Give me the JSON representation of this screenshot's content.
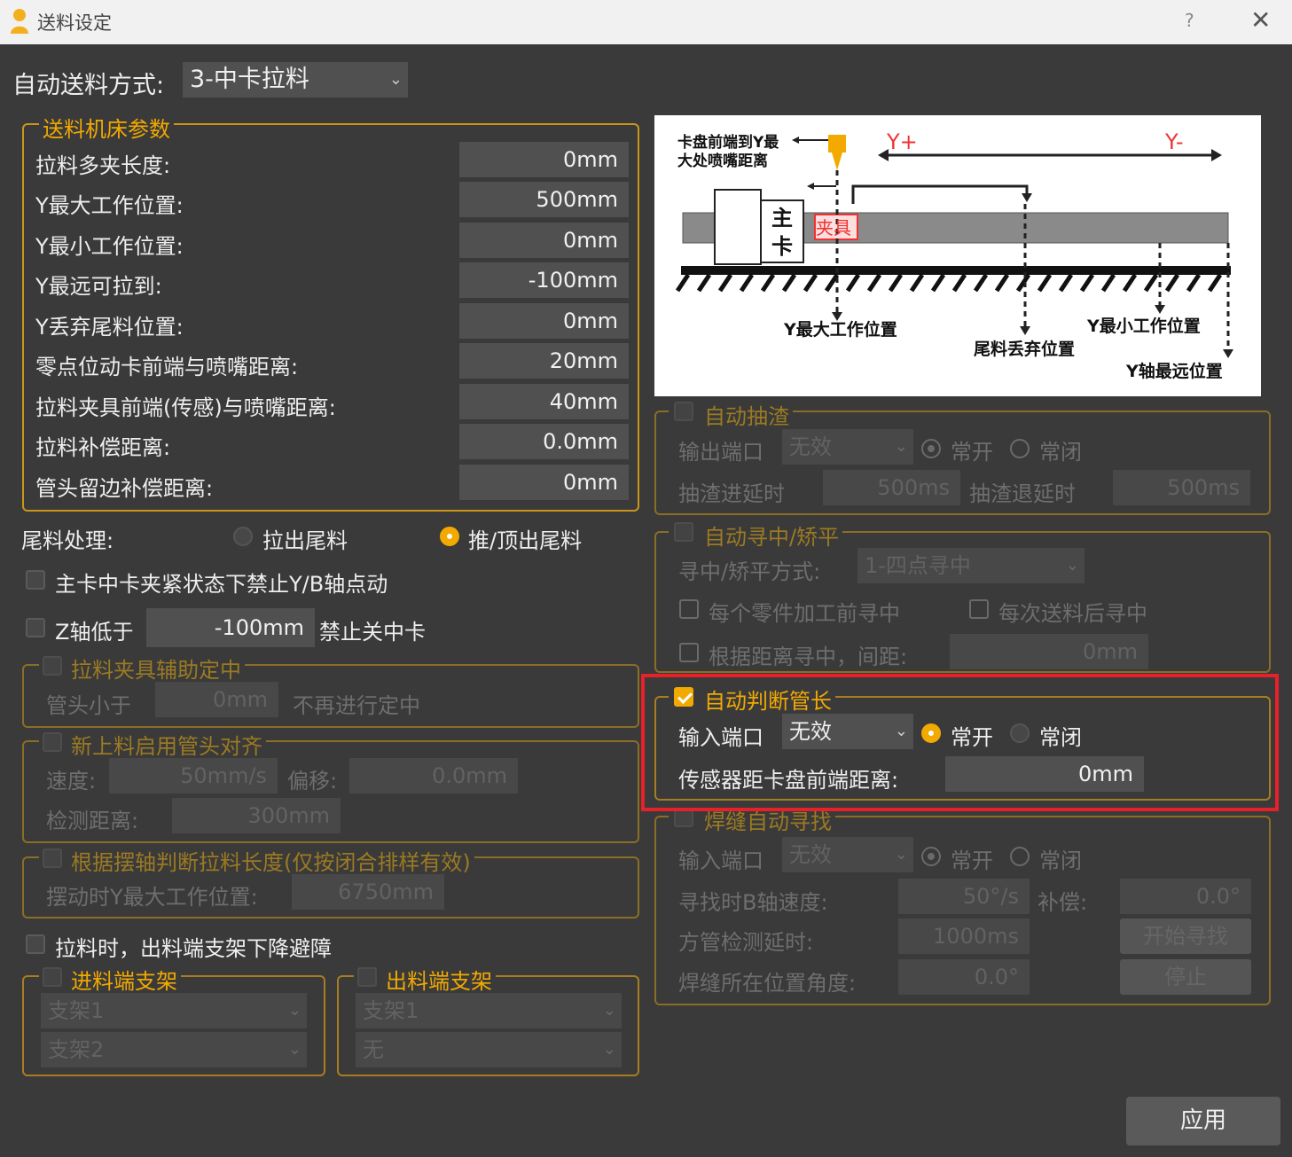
{
  "window": {
    "title": "送料设定",
    "help": "?",
    "close": "✕"
  },
  "auto_feed": {
    "label": "自动送料方式:",
    "value": "3-中卡拉料"
  },
  "machine_params": {
    "title": "送料机床参数",
    "rows": [
      {
        "label": "拉料多夹长度:",
        "value": "0mm"
      },
      {
        "label": "Y最大工作位置:",
        "value": "500mm"
      },
      {
        "label": "Y最小工作位置:",
        "value": "0mm"
      },
      {
        "label": "Y最远可拉到:",
        "value": "-100mm"
      },
      {
        "label": "Y丢弃尾料位置:",
        "value": "0mm"
      },
      {
        "label": "零点位动卡前端与喷嘴距离:",
        "value": "20mm"
      },
      {
        "label": "拉料夹具前端(传感)与喷嘴距离:",
        "value": "40mm"
      },
      {
        "label": "拉料补偿距离:",
        "value": "0.0mm"
      },
      {
        "label": "管头留边补偿距离:",
        "value": "0mm"
      }
    ]
  },
  "tail": {
    "label": "尾料处理:",
    "opt1": "拉出尾料",
    "opt2": "推/顶出尾料"
  },
  "chuck_lock": {
    "label": "主卡中卡夹紧状态下禁止Y/B轴点动"
  },
  "z_axis": {
    "label": "Z轴低于",
    "value": "-100mm",
    "suffix": "禁止关中卡"
  },
  "assist": {
    "title": "拉料夹具辅助定中",
    "label": "管头小于",
    "value": "0mm",
    "suffix": "不再进行定中"
  },
  "align": {
    "title": "新上料启用管头对齐",
    "speed_label": "速度:",
    "speed": "50mm/s",
    "offset_label": "偏移:",
    "offset": "0.0mm",
    "detect_label": "检测距离:",
    "detect": "300mm"
  },
  "swing": {
    "title": "根据摆轴判断拉料长度(仅按闭合排样有效)",
    "label": "摆动时Y最大工作位置:",
    "value": "6750mm"
  },
  "support_drop": {
    "label": "拉料时，出料端支架下降避障"
  },
  "in_support": {
    "title": "进料端支架",
    "opt1": "支架1",
    "opt2": "支架2"
  },
  "out_support": {
    "title": "出料端支架",
    "opt1": "支架1",
    "opt2": "无"
  },
  "diagram": {
    "t1": "卡盘前端到Y最",
    "t2": "大处喷嘴距离",
    "yplus": "Y+",
    "yminus": "Y-",
    "zhu": "主",
    "ka": "卡",
    "jiaju": "夹具",
    "ymax": "Y最大工作位置",
    "tail": "尾料丢弃位置",
    "ymin": "Y最小工作位置",
    "yfar": "Y轴最远位置"
  },
  "slag": {
    "title": "自动抽渣",
    "port_label": "输出端口",
    "port": "无效",
    "no": "常开",
    "nc": "常闭",
    "in_label": "抽渣进延时",
    "in_value": "500ms",
    "out_label": "抽渣退延时",
    "out_value": "500ms"
  },
  "center": {
    "title": "自动寻中/矫平",
    "mode_label": "寻中/矫平方式:",
    "mode": "1-四点寻中",
    "each_part": "每个零件加工前寻中",
    "each_feed": "每次送料后寻中",
    "by_dist": "根据距离寻中，间距:",
    "dist": "0mm"
  },
  "tube_len": {
    "title": "自动判断管长",
    "port_label": "输入端口",
    "port": "无效",
    "no": "常开",
    "nc": "常闭",
    "dist_label": "传感器距卡盘前端距离:",
    "dist": "0mm"
  },
  "weld": {
    "title": "焊缝自动寻找",
    "port_label": "输入端口",
    "port": "无效",
    "no": "常开",
    "nc": "常闭",
    "speed_label": "寻找时B轴速度:",
    "speed": "50°/s",
    "comp_label": "补偿:",
    "comp": "0.0°",
    "delay_label": "方管检测延时:",
    "delay": "1000ms",
    "start": "开始寻找",
    "angle_label": "焊缝所在位置角度:",
    "angle": "0.0°",
    "stop": "停止"
  },
  "apply": "应用"
}
